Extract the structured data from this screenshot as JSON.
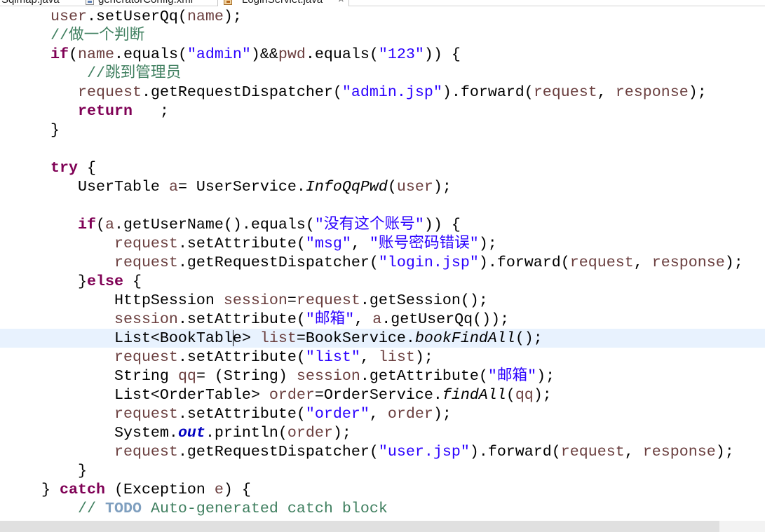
{
  "editor": {
    "tabs": [
      {
        "label": "Sqlmap.java",
        "active": false
      },
      {
        "label": "generatorConfig.xml",
        "icon": "xml-file-icon",
        "active": false
      },
      {
        "label": "LoginServlet.java",
        "icon": "java-file-icon",
        "active": true,
        "close_glyph": "×"
      }
    ],
    "colors": {
      "keyword": "#7F0055",
      "string": "#2A00FF",
      "comment": "#3F7F5F",
      "task_tag": "#7F9FBF",
      "local_variable": "#6A3E3E",
      "static_field": "#0000C0",
      "text": "#000000",
      "current_line_highlight": "#E8F2FE"
    },
    "horizontal_scrollbar": {
      "visible_content_percent": 94
    },
    "lines": [
      {
        "tokens": [
          {
            "k": "ws",
            "t": "     "
          },
          {
            "k": "var",
            "t": "user"
          },
          {
            "k": "p",
            "t": ".setUserQq("
          },
          {
            "k": "var",
            "t": "name"
          },
          {
            "k": "p",
            "t": ");"
          }
        ]
      },
      {
        "tokens": [
          {
            "k": "ws",
            "t": "     "
          },
          {
            "k": "cmt",
            "t": "//做一个判断"
          }
        ]
      },
      {
        "tokens": [
          {
            "k": "ws",
            "t": "     "
          },
          {
            "k": "kw",
            "t": "if"
          },
          {
            "k": "p",
            "t": "("
          },
          {
            "k": "var",
            "t": "name"
          },
          {
            "k": "p",
            "t": ".equals("
          },
          {
            "k": "str",
            "t": "\"admin\""
          },
          {
            "k": "p",
            "t": ")&&"
          },
          {
            "k": "var",
            "t": "pwd"
          },
          {
            "k": "p",
            "t": ".equals("
          },
          {
            "k": "str",
            "t": "\"123\""
          },
          {
            "k": "p",
            "t": ")) {"
          }
        ]
      },
      {
        "tokens": [
          {
            "k": "ws",
            "t": "         "
          },
          {
            "k": "cmt",
            "t": "//跳到管理员"
          }
        ]
      },
      {
        "tokens": [
          {
            "k": "ws",
            "t": "        "
          },
          {
            "k": "var",
            "t": "request"
          },
          {
            "k": "p",
            "t": ".getRequestDispatcher("
          },
          {
            "k": "str",
            "t": "\"admin.jsp\""
          },
          {
            "k": "p",
            "t": ").forward("
          },
          {
            "k": "var",
            "t": "request"
          },
          {
            "k": "p",
            "t": ", "
          },
          {
            "k": "var",
            "t": "response"
          },
          {
            "k": "p",
            "t": ");"
          }
        ]
      },
      {
        "tokens": [
          {
            "k": "ws",
            "t": "        "
          },
          {
            "k": "kw",
            "t": "return"
          },
          {
            "k": "p",
            "t": "   ;"
          }
        ]
      },
      {
        "tokens": [
          {
            "k": "ws",
            "t": "     "
          },
          {
            "k": "p",
            "t": "}"
          }
        ]
      },
      {
        "tokens": []
      },
      {
        "tokens": [
          {
            "k": "ws",
            "t": "     "
          },
          {
            "k": "kw",
            "t": "try"
          },
          {
            "k": "p",
            "t": " {"
          }
        ]
      },
      {
        "tokens": [
          {
            "k": "ws",
            "t": "        "
          },
          {
            "k": "p",
            "t": "UserTable "
          },
          {
            "k": "var",
            "t": "a"
          },
          {
            "k": "p",
            "t": "= UserService."
          },
          {
            "k": "sm",
            "t": "InfoQqPwd"
          },
          {
            "k": "p",
            "t": "("
          },
          {
            "k": "var",
            "t": "user"
          },
          {
            "k": "p",
            "t": ");"
          }
        ]
      },
      {
        "tokens": []
      },
      {
        "tokens": [
          {
            "k": "ws",
            "t": "        "
          },
          {
            "k": "kw",
            "t": "if"
          },
          {
            "k": "p",
            "t": "("
          },
          {
            "k": "var",
            "t": "a"
          },
          {
            "k": "p",
            "t": ".getUserName().equals("
          },
          {
            "k": "str",
            "t": "\"没有这个账号\""
          },
          {
            "k": "p",
            "t": ")) {"
          }
        ]
      },
      {
        "tokens": [
          {
            "k": "ws",
            "t": "            "
          },
          {
            "k": "var",
            "t": "request"
          },
          {
            "k": "p",
            "t": ".setAttribute("
          },
          {
            "k": "str",
            "t": "\"msg\""
          },
          {
            "k": "p",
            "t": ", "
          },
          {
            "k": "str",
            "t": "\"账号密码错误\""
          },
          {
            "k": "p",
            "t": ");"
          }
        ]
      },
      {
        "tokens": [
          {
            "k": "ws",
            "t": "            "
          },
          {
            "k": "var",
            "t": "request"
          },
          {
            "k": "p",
            "t": ".getRequestDispatcher("
          },
          {
            "k": "str",
            "t": "\"login.jsp\""
          },
          {
            "k": "p",
            "t": ").forward("
          },
          {
            "k": "var",
            "t": "request"
          },
          {
            "k": "p",
            "t": ", "
          },
          {
            "k": "var",
            "t": "response"
          },
          {
            "k": "p",
            "t": ");"
          }
        ]
      },
      {
        "tokens": [
          {
            "k": "ws",
            "t": "        "
          },
          {
            "k": "p",
            "t": "}"
          },
          {
            "k": "kw",
            "t": "else"
          },
          {
            "k": "p",
            "t": " {"
          }
        ]
      },
      {
        "tokens": [
          {
            "k": "ws",
            "t": "            "
          },
          {
            "k": "p",
            "t": "HttpSession "
          },
          {
            "k": "var",
            "t": "session"
          },
          {
            "k": "p",
            "t": "="
          },
          {
            "k": "var",
            "t": "request"
          },
          {
            "k": "p",
            "t": ".getSession();"
          }
        ]
      },
      {
        "tokens": [
          {
            "k": "ws",
            "t": "            "
          },
          {
            "k": "var",
            "t": "session"
          },
          {
            "k": "p",
            "t": ".setAttribute("
          },
          {
            "k": "str",
            "t": "\"邮箱\""
          },
          {
            "k": "p",
            "t": ", "
          },
          {
            "k": "var",
            "t": "a"
          },
          {
            "k": "p",
            "t": ".getUserQq());"
          }
        ]
      },
      {
        "current": true,
        "tokens": [
          {
            "k": "ws",
            "t": "            "
          },
          {
            "k": "p",
            "t": "List<BookTabl"
          },
          {
            "k": "caret"
          },
          {
            "k": "p",
            "t": "e> "
          },
          {
            "k": "var",
            "t": "list"
          },
          {
            "k": "p",
            "t": "=BookService."
          },
          {
            "k": "sm",
            "t": "bookFindAll"
          },
          {
            "k": "p",
            "t": "();"
          }
        ]
      },
      {
        "tokens": [
          {
            "k": "ws",
            "t": "            "
          },
          {
            "k": "var",
            "t": "request"
          },
          {
            "k": "p",
            "t": ".setAttribute("
          },
          {
            "k": "str",
            "t": "\"list\""
          },
          {
            "k": "p",
            "t": ", "
          },
          {
            "k": "var",
            "t": "list"
          },
          {
            "k": "p",
            "t": ");"
          }
        ]
      },
      {
        "tokens": [
          {
            "k": "ws",
            "t": "            "
          },
          {
            "k": "p",
            "t": "String "
          },
          {
            "k": "var",
            "t": "qq"
          },
          {
            "k": "p",
            "t": "= (String) "
          },
          {
            "k": "var",
            "t": "session"
          },
          {
            "k": "p",
            "t": ".getAttribute("
          },
          {
            "k": "str",
            "t": "\"邮箱\""
          },
          {
            "k": "p",
            "t": ");"
          }
        ]
      },
      {
        "tokens": [
          {
            "k": "ws",
            "t": "            "
          },
          {
            "k": "p",
            "t": "List<OrderTable> "
          },
          {
            "k": "var",
            "t": "order"
          },
          {
            "k": "p",
            "t": "=OrderService."
          },
          {
            "k": "sm",
            "t": "findAll"
          },
          {
            "k": "p",
            "t": "("
          },
          {
            "k": "var",
            "t": "qq"
          },
          {
            "k": "p",
            "t": ");"
          }
        ]
      },
      {
        "tokens": [
          {
            "k": "ws",
            "t": "            "
          },
          {
            "k": "var",
            "t": "request"
          },
          {
            "k": "p",
            "t": ".setAttribute("
          },
          {
            "k": "str",
            "t": "\"order\""
          },
          {
            "k": "p",
            "t": ", "
          },
          {
            "k": "var",
            "t": "order"
          },
          {
            "k": "p",
            "t": ");"
          }
        ]
      },
      {
        "tokens": [
          {
            "k": "ws",
            "t": "            "
          },
          {
            "k": "p",
            "t": "System."
          },
          {
            "k": "sf",
            "t": "out"
          },
          {
            "k": "p",
            "t": ".println("
          },
          {
            "k": "var",
            "t": "order"
          },
          {
            "k": "p",
            "t": ");"
          }
        ]
      },
      {
        "tokens": [
          {
            "k": "ws",
            "t": "            "
          },
          {
            "k": "var",
            "t": "request"
          },
          {
            "k": "p",
            "t": ".getRequestDispatcher("
          },
          {
            "k": "str",
            "t": "\"user.jsp\""
          },
          {
            "k": "p",
            "t": ").forward("
          },
          {
            "k": "var",
            "t": "request"
          },
          {
            "k": "p",
            "t": ", "
          },
          {
            "k": "var",
            "t": "response"
          },
          {
            "k": "p",
            "t": ");"
          }
        ]
      },
      {
        "tokens": [
          {
            "k": "ws",
            "t": "        "
          },
          {
            "k": "p",
            "t": "}"
          }
        ]
      },
      {
        "tokens": [
          {
            "k": "ws",
            "t": "    "
          },
          {
            "k": "p",
            "t": "} "
          },
          {
            "k": "kw",
            "t": "catch"
          },
          {
            "k": "p",
            "t": " (Exception "
          },
          {
            "k": "var",
            "t": "e"
          },
          {
            "k": "p",
            "t": ") {"
          }
        ]
      },
      {
        "tokens": [
          {
            "k": "ws",
            "t": "        "
          },
          {
            "k": "cmt",
            "t": "// "
          },
          {
            "k": "task",
            "t": "TODO"
          },
          {
            "k": "cmt",
            "t": " Auto-generated catch block"
          }
        ]
      }
    ]
  }
}
